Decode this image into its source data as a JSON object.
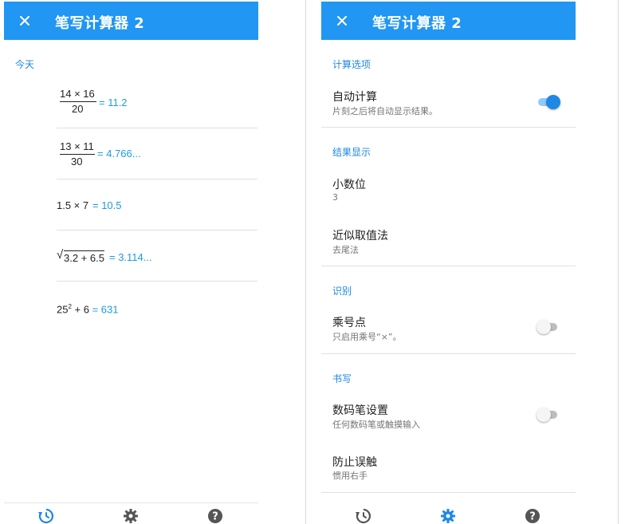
{
  "colors": {
    "primary": "#2196f3",
    "accent": "#1e88e5",
    "result": "#1e9be0"
  },
  "left": {
    "app_title": "笔写计算器 2",
    "section_today": "今天",
    "calculations": [
      {
        "numerator": "14 × 16",
        "denominator": "20",
        "result": "= 11.2"
      },
      {
        "numerator": "13 × 11",
        "denominator": "30",
        "result": "= 4.766..."
      },
      {
        "expression": "1.5 × 7",
        "result": "= 10.5"
      },
      {
        "radicand": "3.2 + 6.5",
        "result": "= 3.114..."
      },
      {
        "base": "25",
        "exponent": "2",
        "rest": " + 6",
        "result": "= 631"
      }
    ],
    "nav": [
      {
        "icon": "history-icon",
        "active": true
      },
      {
        "icon": "settings-icon",
        "active": false
      },
      {
        "icon": "help-icon",
        "active": false
      }
    ]
  },
  "right": {
    "app_title": "笔写计算器 2",
    "sections": {
      "calc_options": "计算选项",
      "result_display": "结果显示",
      "recognition": "识别",
      "writing": "书写"
    },
    "settings": {
      "auto_calc": {
        "title": "自动计算",
        "subtitle": "片刻之后将自动显示结果。",
        "enabled": true
      },
      "decimals": {
        "title": "小数位",
        "value": "3"
      },
      "rounding": {
        "title": "近似取值法",
        "value": "去尾法"
      },
      "mult_dot": {
        "title": "乘号点",
        "subtitle": "只启用乘号“×”。",
        "enabled": false
      },
      "pen": {
        "title": "数码笔设置",
        "subtitle": "任何数码笔或触摸输入",
        "enabled": false
      },
      "palm": {
        "title": "防止误触",
        "value": "惯用右手"
      }
    },
    "nav": [
      {
        "icon": "history-icon",
        "active": false
      },
      {
        "icon": "settings-icon",
        "active": true
      },
      {
        "icon": "help-icon",
        "active": false
      }
    ]
  }
}
